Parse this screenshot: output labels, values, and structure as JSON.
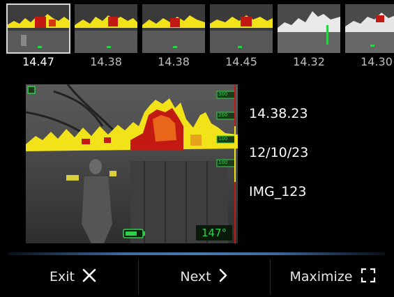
{
  "thumbnails": [
    {
      "label": "14.47",
      "selected": true
    },
    {
      "label": "14.38",
      "selected": false
    },
    {
      "label": "14.38",
      "selected": false
    },
    {
      "label": "14.45",
      "selected": false
    },
    {
      "label": "14.32",
      "selected": false
    },
    {
      "label": "14.30",
      "selected": false
    }
  ],
  "preview": {
    "time": "14.38.23",
    "date": "12/10/23",
    "filename": "IMG_123",
    "temperature": "147°",
    "scale_marks": [
      "300",
      "200",
      "100",
      "100"
    ]
  },
  "buttons": {
    "exit": "Exit",
    "next": "Next",
    "maximize": "Maximize"
  },
  "icons": {
    "exit": "close-icon",
    "next": "chevron-right-icon",
    "maximize": "maximize-icon",
    "battery": "battery-icon",
    "mode": "mode-indicator-icon"
  },
  "colors": {
    "hot_yellow": "#f2e21a",
    "hot_red": "#c21a12",
    "accent_green": "#2fd14a",
    "bar_blue": "#4b7bb3"
  }
}
